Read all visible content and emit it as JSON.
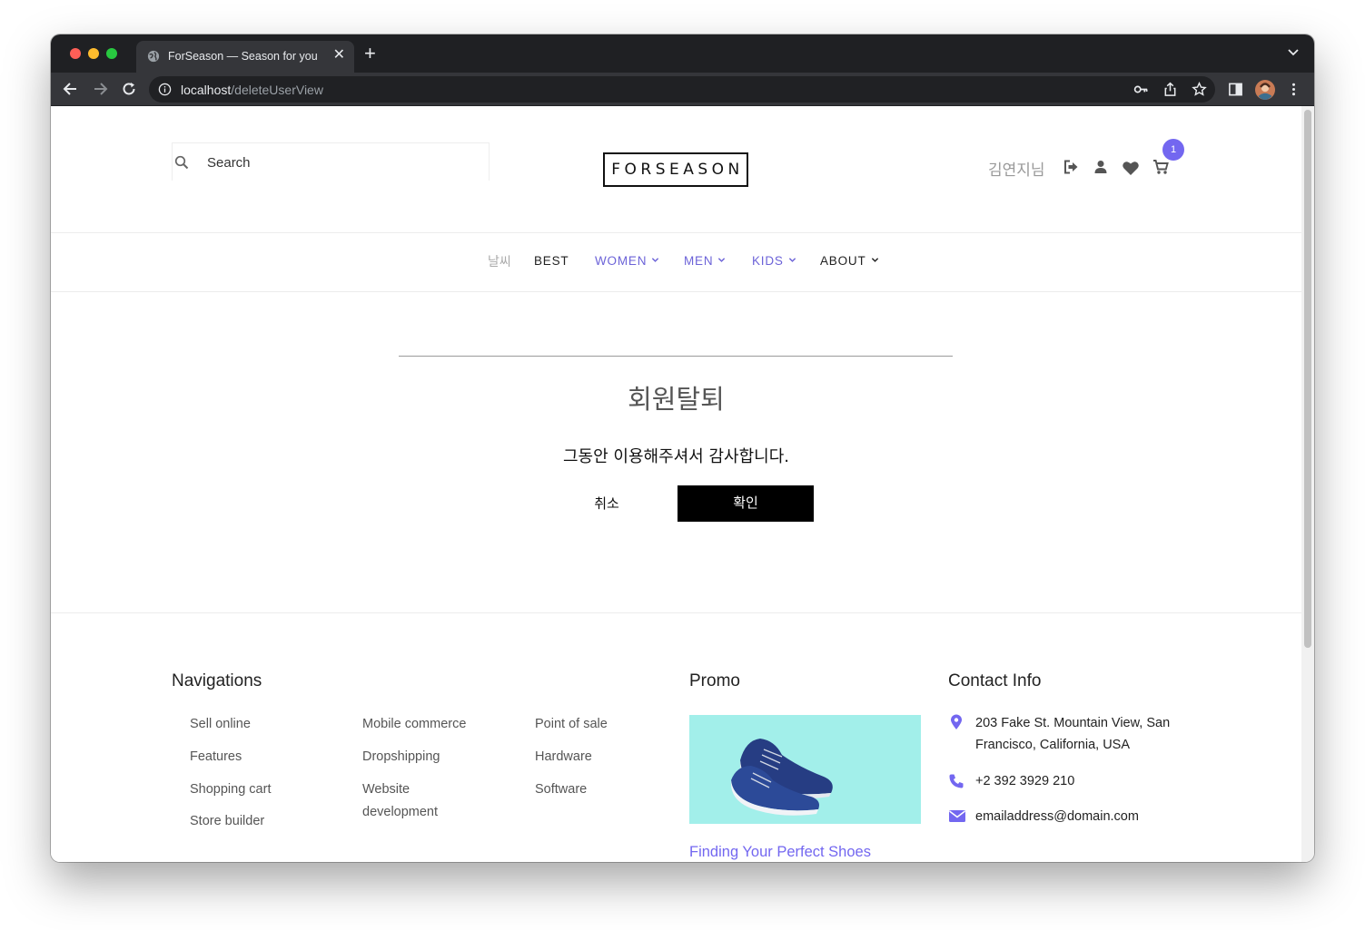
{
  "browser": {
    "tab_title": "ForSeason — Season for you",
    "url_host": "localhost",
    "url_path": "/deleteUserView"
  },
  "header": {
    "search_placeholder": "Search",
    "logo_text": "FORSEASON",
    "username": "김연지님",
    "cart_count": "1",
    "accent_color": "#7367f0"
  },
  "nav": {
    "weather": "날씨",
    "best": "BEST",
    "women": "WOMEN",
    "men": "MEN",
    "kids": "KIDS",
    "about": "ABOUT"
  },
  "main": {
    "title": "회원탈퇴",
    "message": "그동안 이용해주셔서 감사합니다.",
    "cancel_label": "취소",
    "confirm_label": "확인"
  },
  "footer": {
    "nav_heading": "Navigations",
    "nav_col1": [
      "Sell online",
      "Features",
      "Shopping cart",
      "Store builder"
    ],
    "nav_col2": [
      "Mobile commerce",
      "Dropshipping",
      "Website development"
    ],
    "nav_col3": [
      "Point of sale",
      "Hardware",
      "Software"
    ],
    "promo_heading": "Promo",
    "promo_link": "Finding Your Perfect Shoes",
    "contact_heading": "Contact Info",
    "address": "203 Fake St. Mountain View, San Francisco, California, USA",
    "phone": "+2 392 3929 210",
    "email": "emailaddress@domain.com"
  }
}
